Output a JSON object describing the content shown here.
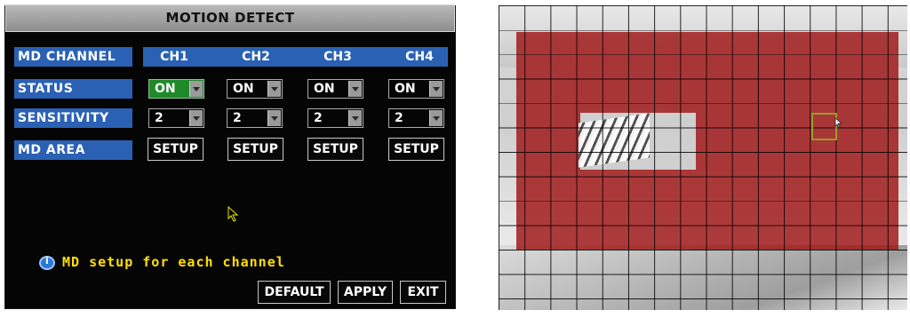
{
  "menu": {
    "title": "MOTION DETECT",
    "row_labels": {
      "channel": "MD CHANNEL",
      "status": "STATUS",
      "sensitivity": "SENSITIVITY",
      "area": "MD AREA"
    },
    "channels": [
      {
        "name": "CH1",
        "status": "ON",
        "sensitivity": "2",
        "area_button": "SETUP"
      },
      {
        "name": "CH2",
        "status": "ON",
        "sensitivity": "2",
        "area_button": "SETUP"
      },
      {
        "name": "CH3",
        "status": "ON",
        "sensitivity": "2",
        "area_button": "SETUP"
      },
      {
        "name": "CH4",
        "status": "ON",
        "sensitivity": "2",
        "area_button": "SETUP"
      }
    ],
    "hint": "MD setup for each channel",
    "buttons": {
      "default": "DEFAULT",
      "apply": "APPLY",
      "exit": "EXIT"
    },
    "icons": {
      "hint_icon": "info-icon",
      "dropdown_icon": "dropdown-arrow-icon",
      "pointer_icon": "mouse-pointer-icon"
    }
  },
  "preview": {
    "detection_color": "#a01414",
    "grid_color": "#000000",
    "selection_color": "#9a9a2a"
  },
  "colors": {
    "label_blue": "#2a61b4",
    "focused_green": "#1e8a2a",
    "hint_yellow": "#ffe000",
    "panel_bg": "#050505"
  }
}
